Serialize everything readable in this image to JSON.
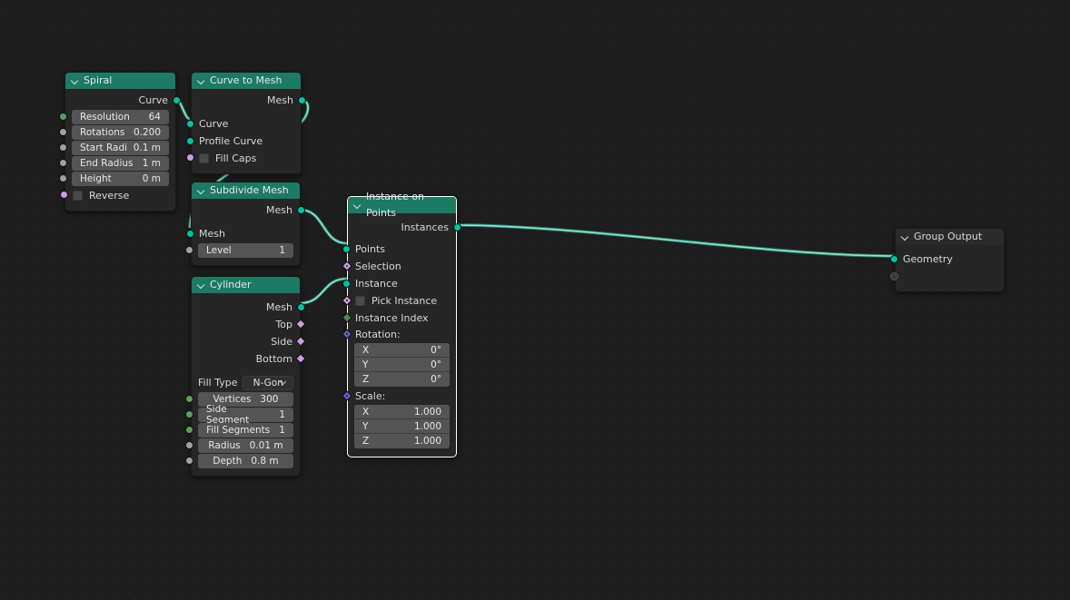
{
  "editor": {
    "background_color": "#1d1d1d",
    "grid_dot_color": "#262626",
    "wire_color": "#9fe0cf",
    "header_color": "#1d7a64"
  },
  "nodes": {
    "spiral": {
      "title": "Spiral",
      "outputs": [
        {
          "label": "Curve",
          "socket": "geometry"
        }
      ],
      "fields": [
        {
          "name": "Resolution",
          "value": "64",
          "socket": "integer"
        },
        {
          "name": "Rotations",
          "value": "0.200",
          "socket": "float"
        },
        {
          "name": "Start Radi",
          "value": "0.1 m",
          "socket": "float"
        },
        {
          "name": "End Radius",
          "value": "1 m",
          "socket": "float"
        },
        {
          "name": "Height",
          "value": "0 m",
          "socket": "float"
        }
      ],
      "checkbox": {
        "label": "Reverse",
        "checked": false,
        "socket": "boolean"
      }
    },
    "curve_to_mesh": {
      "title": "Curve to Mesh",
      "outputs": [
        {
          "label": "Mesh",
          "socket": "geometry"
        }
      ],
      "inputs": [
        {
          "label": "Curve",
          "socket": "geometry"
        },
        {
          "label": "Profile Curve",
          "socket": "geometry"
        }
      ],
      "checkbox": {
        "label": "Fill Caps",
        "checked": false,
        "socket": "boolean"
      }
    },
    "subdivide_mesh": {
      "title": "Subdivide Mesh",
      "outputs": [
        {
          "label": "Mesh",
          "socket": "geometry"
        }
      ],
      "inputs": [
        {
          "label": "Mesh",
          "socket": "geometry"
        }
      ],
      "fields": [
        {
          "name": "Level",
          "value": "1",
          "socket": "integer"
        }
      ]
    },
    "cylinder": {
      "title": "Cylinder",
      "outputs": [
        {
          "label": "Mesh",
          "socket": "geometry"
        },
        {
          "label": "Top",
          "socket": "boolean-field"
        },
        {
          "label": "Side",
          "socket": "boolean-field"
        },
        {
          "label": "Bottom",
          "socket": "boolean-field"
        }
      ],
      "dropdown": {
        "label": "Fill Type",
        "value": "N-Gon"
      },
      "fields": [
        {
          "name": "Vertices",
          "value": "300",
          "socket": "integer"
        },
        {
          "name": "Side Segment",
          "value": "1",
          "socket": "integer"
        },
        {
          "name": "Fill Segments",
          "value": "1",
          "socket": "integer"
        },
        {
          "name": "Radius",
          "value": "0.01 m",
          "socket": "float"
        },
        {
          "name": "Depth",
          "value": "0.8 m",
          "socket": "float"
        }
      ]
    },
    "instance_on_points": {
      "title": "Instance on Points",
      "selected": true,
      "outputs": [
        {
          "label": "Instances",
          "socket": "geometry"
        }
      ],
      "inputs": [
        {
          "label": "Points",
          "socket": "geometry"
        },
        {
          "label": "Selection",
          "socket": "boolean-field"
        },
        {
          "label": "Instance",
          "socket": "geometry"
        }
      ],
      "checkbox": {
        "label": "Pick Instance",
        "checked": false,
        "socket": "boolean-field"
      },
      "instance_index": {
        "label": "Instance Index",
        "socket": "integer-field"
      },
      "rotation": {
        "label": "Rotation:",
        "socket": "vector-field",
        "axes": [
          {
            "name": "X",
            "value": "0°"
          },
          {
            "name": "Y",
            "value": "0°"
          },
          {
            "name": "Z",
            "value": "0°"
          }
        ]
      },
      "scale": {
        "label": "Scale:",
        "socket": "vector-field",
        "axes": [
          {
            "name": "X",
            "value": "1.000"
          },
          {
            "name": "Y",
            "value": "1.000"
          },
          {
            "name": "Z",
            "value": "1.000"
          }
        ]
      }
    },
    "group_output": {
      "title": "Group Output",
      "inputs": [
        {
          "label": "Geometry",
          "socket": "geometry"
        },
        {
          "label": "",
          "socket": "empty"
        }
      ]
    }
  },
  "socket_colors": {
    "geometry": "#00c2a0",
    "float": "#a1a1a1",
    "integer": "#5ba05b",
    "boolean": "#cd9ce0",
    "boolean-field": "#cd9ce0",
    "integer-field": "#4f8a55",
    "vector-field": "#6363c7"
  }
}
